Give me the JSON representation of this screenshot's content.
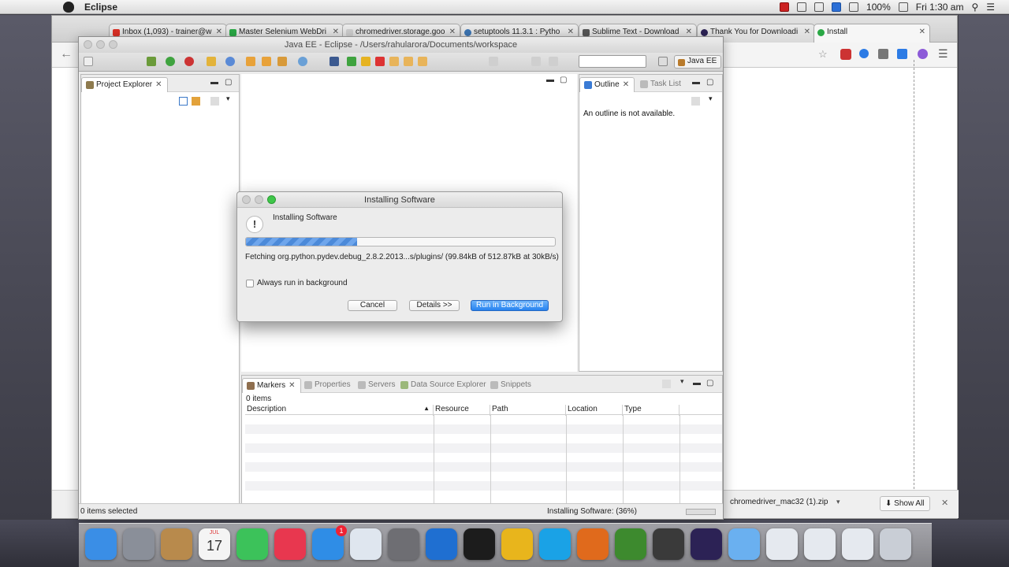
{
  "menubar": {
    "app_name": "Eclipse",
    "battery": "100%",
    "clock": "Fri 1:30 am"
  },
  "chrome": {
    "tabs": [
      {
        "label": "Inbox (1,093) - trainer@w",
        "icon": "gmail-icon",
        "color": "#d93025"
      },
      {
        "label": "Master Selenium WebDri",
        "icon": "udemy-icon",
        "color": "#2aa845"
      },
      {
        "label": "chromedriver.storage.goo",
        "icon": "page-icon",
        "color": "#cccccc"
      },
      {
        "label": "setuptools 11.3.1 : Pytho",
        "icon": "python-icon",
        "color": "#3c74b1"
      },
      {
        "label": "Sublime Text - Download",
        "icon": "sublime-icon",
        "color": "#555555"
      },
      {
        "label": "Thank You for Downloadi",
        "icon": "eclipse-icon",
        "color": "#2c2255"
      },
      {
        "label": "Install",
        "icon": "install-icon",
        "color": "#2aa845"
      }
    ],
    "download": {
      "file": "chromedriver_mac32 (1).zip",
      "show_all": "Show All"
    }
  },
  "eclipse": {
    "title": "Java EE - Eclipse - /Users/rahularora/Documents/workspace",
    "perspective": "Java EE",
    "project_explorer": {
      "tab": "Project Explorer"
    },
    "outline": {
      "tabs": [
        "Outline",
        "Task List"
      ],
      "message": "An outline is not available."
    },
    "bottom": {
      "tabs": [
        "Markers",
        "Properties",
        "Servers",
        "Data Source Explorer",
        "Snippets"
      ],
      "items_count": "0 items",
      "columns": [
        "Description",
        "Resource",
        "Path",
        "Location",
        "Type"
      ]
    },
    "status": {
      "left": "0 items selected",
      "progress": "Installing Software: (36%)"
    }
  },
  "dialog": {
    "title": "Installing Software",
    "heading": "Installing Software",
    "progress_fraction": 0.36,
    "fetch_text": "Fetching org.python.pydev.debug_2.8.2.2013...s/plugins/ (99.84kB of 512.87kB at 30kB/s)",
    "checkbox_label": "Always run in background",
    "buttons": {
      "cancel": "Cancel",
      "details": "Details >>",
      "background": "Run in Background"
    }
  },
  "dock": {
    "apps": [
      {
        "name": "finder-icon",
        "color": "#3a8ee6"
      },
      {
        "name": "launchpad-icon",
        "color": "#8a8f99"
      },
      {
        "name": "contacts-icon",
        "color": "#b88a4c"
      },
      {
        "name": "calendar-icon",
        "color": "#f4f4f4"
      },
      {
        "name": "facetime-icon",
        "color": "#3cc25a"
      },
      {
        "name": "itunes-icon",
        "color": "#e8374f"
      },
      {
        "name": "appstore-icon",
        "color": "#2f8de6"
      },
      {
        "name": "textedit-icon",
        "color": "#dfe6ef"
      },
      {
        "name": "system-preferences-icon",
        "color": "#6e6e73"
      },
      {
        "name": "teamviewer-icon",
        "color": "#1f6fd1"
      },
      {
        "name": "terminal-icon",
        "color": "#1c1c1c"
      },
      {
        "name": "chrome-icon",
        "color": "#e8b51c"
      },
      {
        "name": "skype-icon",
        "color": "#1aa2e6"
      },
      {
        "name": "firefox-icon",
        "color": "#e06a1c"
      },
      {
        "name": "camtasia-icon",
        "color": "#3d8a2e"
      },
      {
        "name": "sublime-icon",
        "color": "#3a3a3a"
      },
      {
        "name": "eclipse-icon",
        "color": "#2c2255"
      },
      {
        "name": "folder-icon",
        "color": "#6ab0f0"
      },
      {
        "name": "screenshot-icon",
        "color": "#e5e9ef"
      },
      {
        "name": "screenshot-icon-2",
        "color": "#e5e9ef"
      },
      {
        "name": "screenshot-icon-3",
        "color": "#e5e9ef"
      },
      {
        "name": "trash-icon",
        "color": "#c9ced6"
      }
    ],
    "badges": {
      "appstore": "1",
      "calendar_day": "17",
      "calendar_month": "JUL"
    }
  }
}
